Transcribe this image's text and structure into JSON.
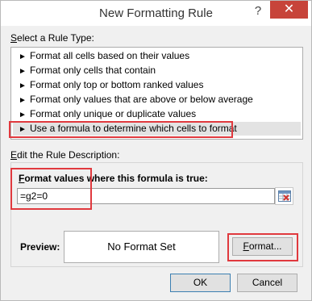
{
  "dialog": {
    "title": "New Formatting Rule",
    "help_label": "?",
    "close_label": "✕"
  },
  "rule_type": {
    "label_prefix": "S",
    "label_rest": "elect a Rule Type:",
    "items": [
      {
        "label": "Format all cells based on their values"
      },
      {
        "label": "Format only cells that contain"
      },
      {
        "label": "Format only top or bottom ranked values"
      },
      {
        "label": "Format only values that are above or below average"
      },
      {
        "label": "Format only unique or duplicate values"
      },
      {
        "label": "Use a formula to determine which cells to format",
        "selected": true
      }
    ],
    "arrow_glyph": "►"
  },
  "description": {
    "label_prefix": "E",
    "label_rest": "dit the Rule Description:",
    "formula_label_prefix": "F",
    "formula_label_rest": "ormat values where this formula is true:",
    "formula_value": "=g2=0"
  },
  "preview": {
    "label": "Preview:",
    "text": "No Format Set"
  },
  "buttons": {
    "format_prefix": "F",
    "format_rest": "ormat...",
    "ok": "OK",
    "cancel": "Cancel"
  },
  "colors": {
    "highlight_frame": "#e0393e",
    "close_button": "#c7443a",
    "selected_row": "#e3e3e3"
  }
}
